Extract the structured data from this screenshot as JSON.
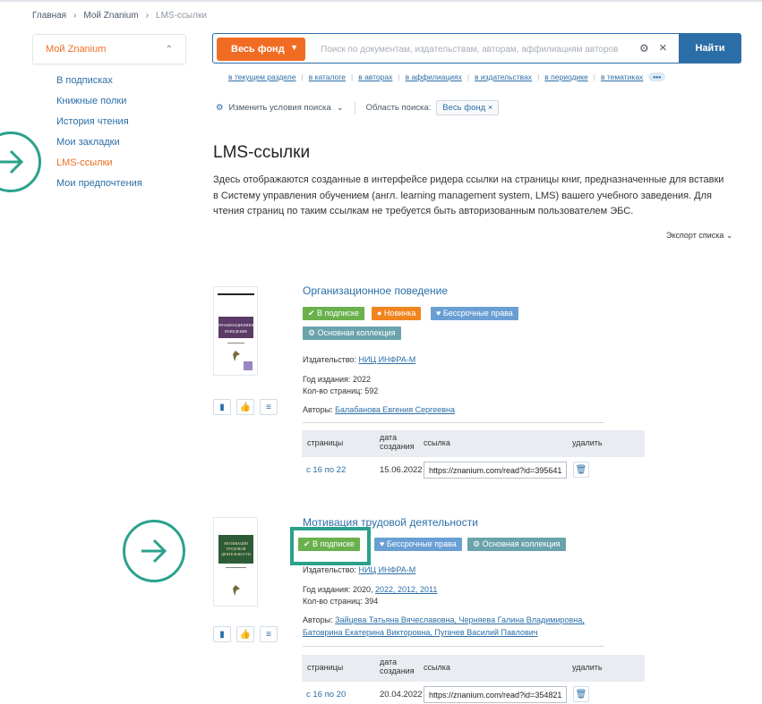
{
  "breadcrumb": [
    "Главная",
    "Мой Znanium",
    "LMS-ссылки"
  ],
  "sidebar": {
    "header": "Мой Znanium",
    "items": [
      {
        "label": "В подписках",
        "active": false
      },
      {
        "label": "Книжные полки",
        "active": false
      },
      {
        "label": "История чтения",
        "active": false
      },
      {
        "label": "Мои закладки",
        "active": false
      },
      {
        "label": "LMS-ссылки",
        "active": true
      },
      {
        "label": "Мои предпочтения",
        "active": false
      }
    ]
  },
  "search": {
    "fund_label": "Весь фонд",
    "placeholder": "Поиск по документам, издательствам, авторам, аффилиациям авторов",
    "button": "Найти",
    "scopes": [
      "в текущем разделе",
      "в каталоге",
      "в авторах",
      "в аффилиациях",
      "в издательствах",
      "в периодике",
      "в тематиках"
    ],
    "more": "•••"
  },
  "conditions": {
    "change_label": "Изменить условия поиска",
    "area_label": "Область поиска:",
    "area_value": "Весь фонд"
  },
  "page": {
    "title": "LMS-ссылки",
    "description": "Здесь отображаются созданные в интерфейсе ридера ссылки на страницы книг, предназначенные для вставки в Систему управления обучением (англ. learning management system, LMS) вашего учебного заведения. Для чтения страниц по таким ссылкам не требуется быть авторизованным пользователем ЭБС.",
    "export": "Экспорт списка"
  },
  "table_headers": {
    "pages": "страницы",
    "created": "дата\nсоздания",
    "link": "ссылка",
    "delete": "удалить"
  },
  "books": [
    {
      "title": "Организационное поведение",
      "cover_text": "ОРГАНИЗАЦИОННОЕ ПОВЕДЕНИЕ",
      "badges": [
        "✔ В подписке",
        "● Новинка",
        "♥ Бессрочные права",
        "⚙ Основная коллекция"
      ],
      "publisher_label": "Издательство:",
      "publisher": "НИЦ ИНФРА-М",
      "year_label": "Год издания:",
      "year": "2022",
      "pages_label": "Кол-во страниц:",
      "pages": "592",
      "authors_label": "Авторы:",
      "authors": "Балабанова Евгения Сергеевна",
      "links": [
        {
          "pages": "с 16 по 22",
          "date": "15.06.2022",
          "url": "https://znanium.com/read?id=395641"
        }
      ]
    },
    {
      "title": "Мотивация трудовой деятельности",
      "cover_text": "МОТИВАЦИЯ ТРУДОВОЙ ДЕЯТЕЛЬНОСТИ",
      "badges": [
        "✔ В подписке",
        "♥ Бессрочные права",
        "⚙ Основная коллекция"
      ],
      "publisher_label": "Издательство:",
      "publisher": "НИЦ ИНФРА-М",
      "year_label": "Год издания:",
      "year": "2020,",
      "years_extra": "2022, 2012, 2011",
      "pages_label": "Кол-во страниц:",
      "pages": "394",
      "authors_label": "Авторы:",
      "authors_line1": "Зайцева Татьяна Вячеславовна, Черняева Галина Владимировна,",
      "authors_line2": "Батоврина Екатерина Викторовна, Пугачев Василий Павлович",
      "links": [
        {
          "pages": "с 16 по 20",
          "date": "20.04.2022",
          "url": "https://znanium.com/read?id=354821"
        }
      ]
    }
  ],
  "colors": {
    "accent": "#ef6c22",
    "primary": "#2b6ea7",
    "annotation": "#2ba18c"
  }
}
